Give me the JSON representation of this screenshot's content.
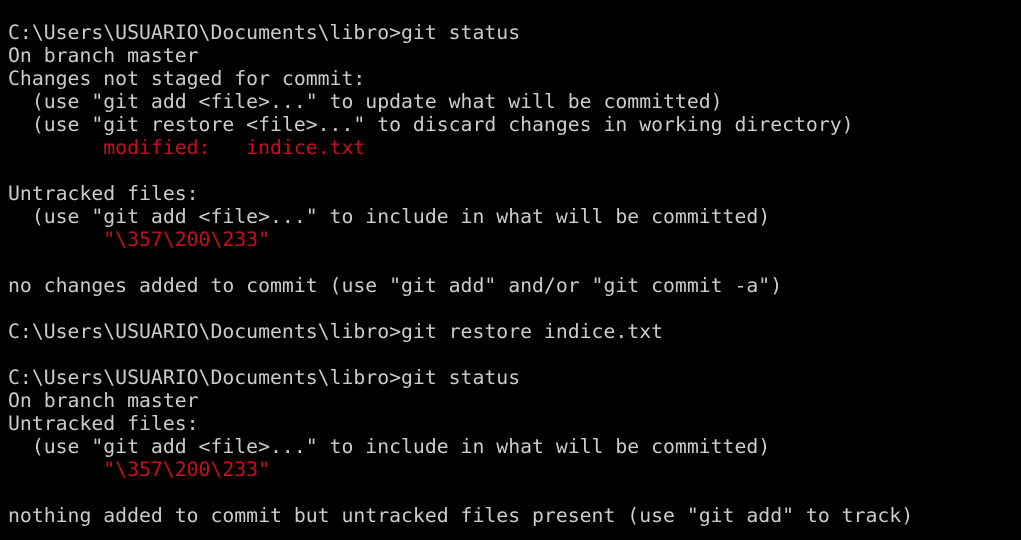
{
  "colors": {
    "background": "#000000",
    "foreground": "#cccccc",
    "git_red": "#c50f1f"
  },
  "terminal": {
    "lines": [
      {
        "text": "C:\\Users\\USUARIO\\Documents\\libro>git status",
        "kind": "prompt"
      },
      {
        "text": "On branch master",
        "kind": "output"
      },
      {
        "text": "Changes not staged for commit:",
        "kind": "output"
      },
      {
        "text": "  (use \"git add <file>...\" to update what will be committed)",
        "kind": "output"
      },
      {
        "text": "  (use \"git restore <file>...\" to discard changes in working directory)",
        "kind": "output"
      },
      {
        "text": "        modified:   indice.txt",
        "kind": "modified"
      },
      {
        "text": "",
        "kind": "blank"
      },
      {
        "text": "Untracked files:",
        "kind": "output"
      },
      {
        "text": "  (use \"git add <file>...\" to include in what will be committed)",
        "kind": "output"
      },
      {
        "text": "        \"\\357\\200\\233\"",
        "kind": "untracked"
      },
      {
        "text": "",
        "kind": "blank"
      },
      {
        "text": "no changes added to commit (use \"git add\" and/or \"git commit -a\")",
        "kind": "output"
      },
      {
        "text": "",
        "kind": "blank"
      },
      {
        "text": "C:\\Users\\USUARIO\\Documents\\libro>git restore indice.txt",
        "kind": "prompt"
      },
      {
        "text": "",
        "kind": "blank"
      },
      {
        "text": "C:\\Users\\USUARIO\\Documents\\libro>git status",
        "kind": "prompt"
      },
      {
        "text": "On branch master",
        "kind": "output"
      },
      {
        "text": "Untracked files:",
        "kind": "output"
      },
      {
        "text": "  (use \"git add <file>...\" to include in what will be committed)",
        "kind": "output"
      },
      {
        "text": "        \"\\357\\200\\233\"",
        "kind": "untracked"
      },
      {
        "text": "",
        "kind": "blank"
      },
      {
        "text": "nothing added to commit but untracked files present (use \"git add\" to track)",
        "kind": "output"
      }
    ]
  }
}
